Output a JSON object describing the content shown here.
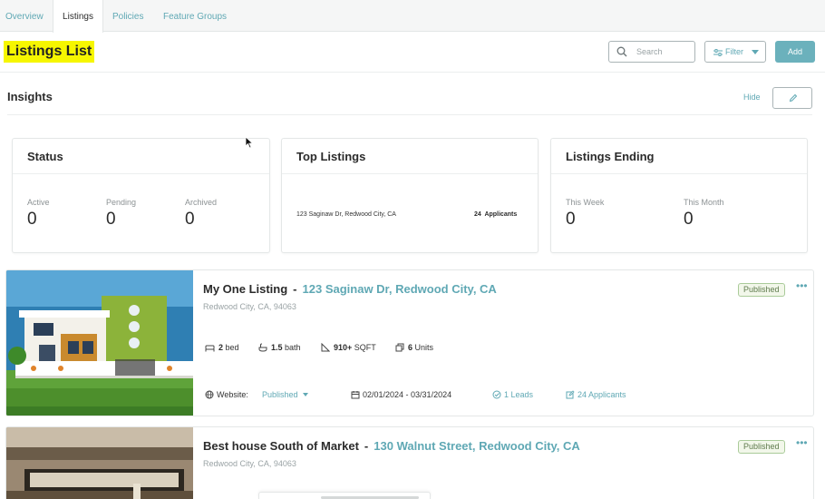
{
  "tabs": [
    {
      "label": "Overview"
    },
    {
      "label": "Listings"
    },
    {
      "label": "Policies"
    },
    {
      "label": "Feature Groups"
    }
  ],
  "header": {
    "title": "Listings List",
    "search_placeholder": "Search",
    "filter_label": "Filter",
    "add_label": "Add"
  },
  "insights": {
    "title": "Insights",
    "hide_label": "Hide",
    "status": {
      "title": "Status",
      "stats": [
        {
          "label": "Active",
          "value": "0"
        },
        {
          "label": "Pending",
          "value": "0"
        },
        {
          "label": "Archived",
          "value": "0"
        }
      ]
    },
    "top_listings": {
      "title": "Top Listings",
      "address": "123 Saginaw Dr, Redwood City, CA",
      "count": "24",
      "count_label": "Applicants"
    },
    "listings_ending": {
      "title": "Listings Ending",
      "stats": [
        {
          "label": "This Week",
          "value": "0"
        },
        {
          "label": "This Month",
          "value": "0"
        }
      ]
    }
  },
  "listings": [
    {
      "name": "My One Listing",
      "separator": "-",
      "address": "123 Saginaw Dr, Redwood City, CA",
      "subaddress": "Redwood City, CA, 94063",
      "status": "Published",
      "beds": "2",
      "beds_label": "bed",
      "baths": "1.5",
      "baths_label": "bath",
      "sqft": "910+",
      "sqft_label": "SQFT",
      "units": "6",
      "units_label": "Units",
      "website_label": "Website:",
      "website_status": "Published",
      "date_range": "02/01/2024 - 03/31/2024",
      "leads": "1 Leads",
      "applicants": "24 Applicants"
    },
    {
      "name": "Best house South of Market",
      "separator": "-",
      "address": "130 Walnut Street, Redwood City, CA",
      "subaddress": "Redwood City, CA, 94063",
      "status": "Published"
    }
  ],
  "colors": {
    "accent": "#5fa8b4",
    "add_button": "#6bb1bc",
    "highlight": "#f6f600",
    "badge_border": "#aacb9a"
  },
  "icons": [
    "search-icon",
    "filter-icon",
    "chevron-down-icon",
    "pencil-icon",
    "more-icon",
    "bed-icon",
    "bath-icon",
    "ruler-icon",
    "units-icon",
    "globe-icon",
    "calendar-icon",
    "leads-check-icon",
    "applicants-edit-icon",
    "cursor-icon"
  ]
}
